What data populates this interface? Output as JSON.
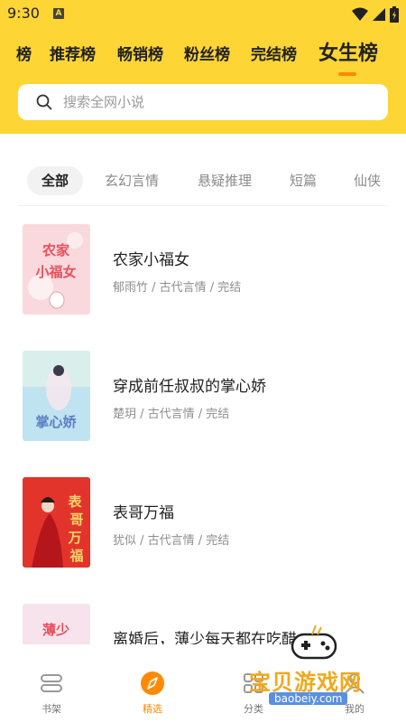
{
  "status": {
    "time": "9:30",
    "app_badge": "A"
  },
  "top_tabs": [
    {
      "label": "榜"
    },
    {
      "label": "推荐榜"
    },
    {
      "label": "畅销榜"
    },
    {
      "label": "粉丝榜"
    },
    {
      "label": "完结榜"
    },
    {
      "label": "女生榜",
      "active": true
    }
  ],
  "search": {
    "placeholder": "搜索全网小说"
  },
  "filters": [
    {
      "label": "全部",
      "active": true
    },
    {
      "label": "玄幻言情"
    },
    {
      "label": "悬疑推理"
    },
    {
      "label": "短篇"
    },
    {
      "label": "仙侠"
    }
  ],
  "books": [
    {
      "title": "农家小福女",
      "meta": "郁雨竹 / 古代言情 / 完结",
      "cover_text": "农家小福女",
      "cover_colors": [
        "#F9D9DD",
        "#E8505B"
      ]
    },
    {
      "title": "穿成前任叔叔的掌心娇",
      "meta": "楚玥 / 古代言情 / 完结",
      "cover_text": "掌心娇",
      "cover_colors": [
        "#BFE3F0",
        "#5A7FC4"
      ]
    },
    {
      "title": "表哥万福",
      "meta": "犹似 / 古代言情 / 完结",
      "cover_text": "表哥万福",
      "cover_colors": [
        "#E3342B",
        "#F7D56A"
      ]
    },
    {
      "title": "离婚后，薄少每天都在吃醋",
      "meta": "",
      "cover_text": "薄少",
      "cover_colors": [
        "#F7E3EC",
        "#E8505B"
      ]
    }
  ],
  "bottom_nav": [
    {
      "label": "书架",
      "icon": "bookshelf-icon"
    },
    {
      "label": "精选",
      "icon": "featured-compass-icon",
      "active": true
    },
    {
      "label": "分类",
      "icon": "category-icon"
    },
    {
      "label": "我的",
      "icon": "profile-icon"
    }
  ],
  "watermark": {
    "text": "宝贝游戏网",
    "url": "baobeiy.com"
  },
  "colors": {
    "brand_yellow": "#FDD535",
    "accent_orange": "#FF8A00"
  }
}
